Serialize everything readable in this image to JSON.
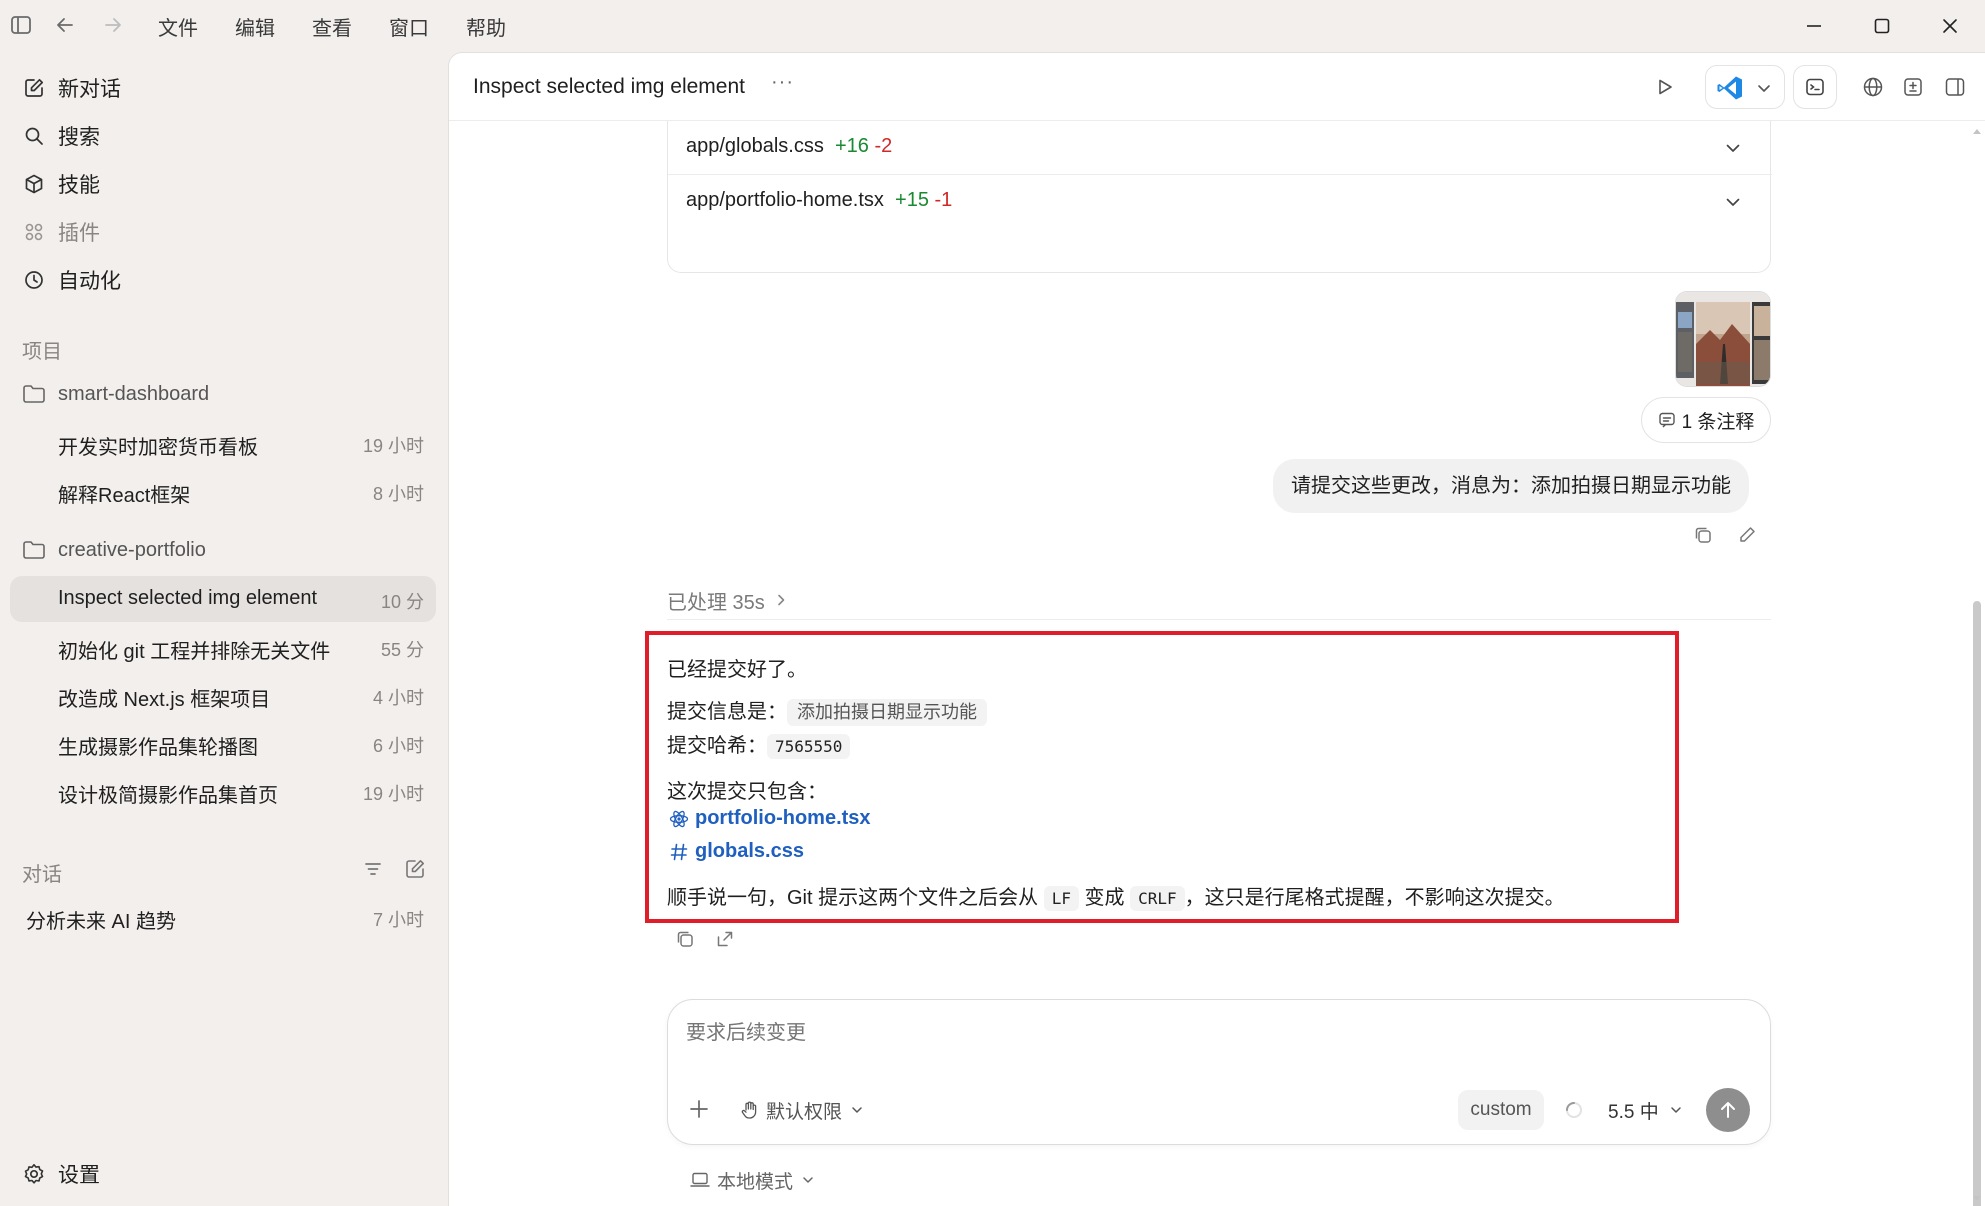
{
  "menubar": {
    "menus": [
      "文件",
      "编辑",
      "查看",
      "窗口",
      "帮助"
    ]
  },
  "sidebar": {
    "nav": [
      {
        "label": "新对话",
        "icon": "edit-icon"
      },
      {
        "label": "搜索",
        "icon": "search-icon"
      },
      {
        "label": "技能",
        "icon": "cube-icon"
      },
      {
        "label": "插件",
        "icon": "grid-icon"
      },
      {
        "label": "自动化",
        "icon": "clock-icon"
      }
    ],
    "projects_label": "项目",
    "projects": [
      {
        "name": "smart-dashboard",
        "threads": [
          {
            "label": "开发实时加密货币看板",
            "time": "19 小时"
          },
          {
            "label": "解释React框架",
            "time": "8 小时"
          }
        ]
      },
      {
        "name": "creative-portfolio",
        "threads": [
          {
            "label": "Inspect selected img element",
            "time": "10 分",
            "active": true
          },
          {
            "label": "初始化 git 工程并排除无关文件",
            "time": "55 分"
          },
          {
            "label": "改造成 Next.js 框架项目",
            "time": "4 小时"
          },
          {
            "label": "生成摄影作品集轮播图",
            "time": "6 小时"
          },
          {
            "label": "设计极简摄影作品集首页",
            "time": "19 小时"
          }
        ]
      }
    ],
    "chats_label": "对话",
    "chats": [
      {
        "label": "分析未来 AI 趋势",
        "time": "7 小时"
      }
    ],
    "settings_label": "设置"
  },
  "header": {
    "title": "Inspect selected img element",
    "more": "···"
  },
  "diffs": [
    {
      "file": "app/globals.css",
      "added": "+16",
      "removed": "-2"
    },
    {
      "file": "app/portfolio-home.tsx",
      "added": "+15",
      "removed": "-1"
    }
  ],
  "user_message": {
    "comment_badge": "1 条注释",
    "text": "请提交这些更改，消息为：添加拍摄日期显示功能"
  },
  "processed": "已处理 35s",
  "answer": {
    "line1": "已经提交好了。",
    "msg_label": "提交信息是：",
    "msg_value": "添加拍摄日期显示功能",
    "hash_label": "提交哈希：",
    "hash_value": "7565550",
    "contains_label": "这次提交只包含：",
    "files": [
      {
        "name": "portfolio-home.tsx",
        "icon": "react-icon"
      },
      {
        "name": "globals.css",
        "icon": "hash-icon"
      }
    ],
    "note_a": "顺手说一句，Git 提示这两个文件之后会从",
    "note_lf": "LF",
    "note_b": "变成",
    "note_crlf": "CRLF",
    "note_c": "，这只是行尾格式提醒，不影响这次提交。"
  },
  "composer": {
    "placeholder": "要求后续变更",
    "permission": "默认权限",
    "custom": "custom",
    "model": "5.5 中"
  },
  "footer": {
    "mode": "本地模式"
  },
  "colors": {
    "accent_red": "#e01e2a",
    "link_blue": "#1f5fbf",
    "added_green": "#1a8a32",
    "removed_red": "#d02828"
  }
}
